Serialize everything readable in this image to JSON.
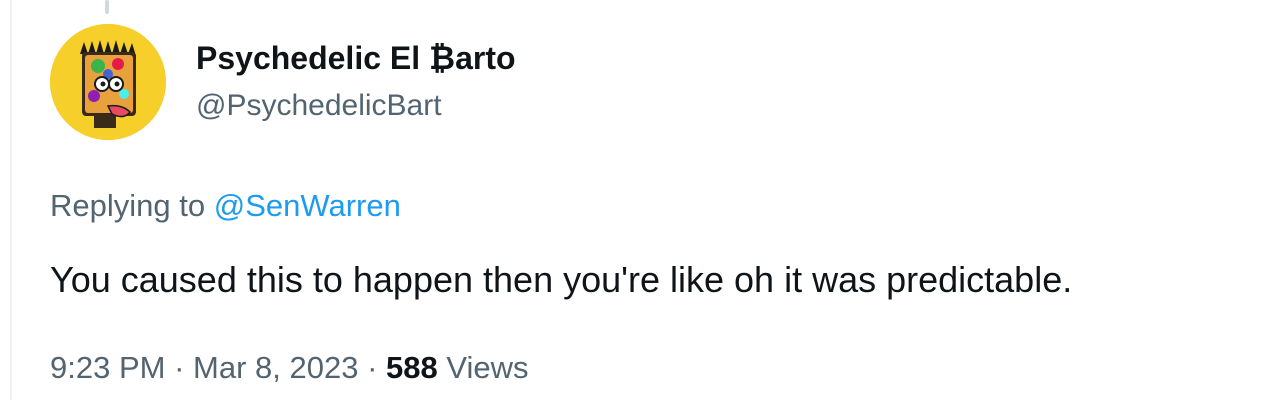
{
  "tweet": {
    "author_name": "Psychedelic El ₿arto",
    "author_handle": "@PsychedelicBart",
    "replying_prefix": "Replying to ",
    "replying_to": "@SenWarren",
    "text": "You caused this to happen then you're like oh it was predictable.",
    "time": "9:23 PM",
    "separator": " · ",
    "date": "Mar 8, 2023",
    "views_count": "588",
    "views_label": " Views"
  },
  "colors": {
    "text_primary": "#0f1419",
    "text_secondary": "#536471",
    "link": "#1d9bf0",
    "avatar_bg": "#f7cf2a"
  },
  "icons": {
    "avatar": "psychedelic-bart-avatar"
  }
}
